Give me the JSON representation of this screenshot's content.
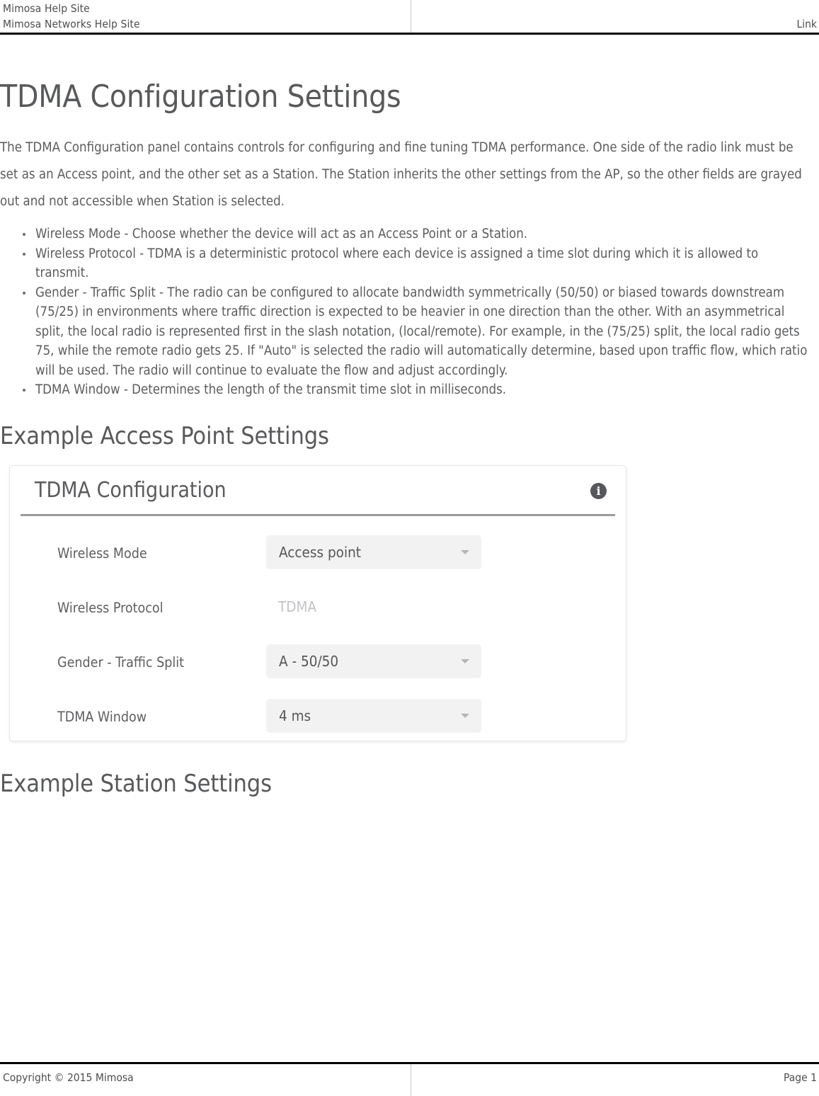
{
  "header": {
    "line1": "Mimosa Help Site",
    "line2": "Mimosa Networks Help Site",
    "right_label": "Link"
  },
  "document": {
    "title": "TDMA Configuration Settings",
    "intro": "The TDMA Configuration panel contains controls for configuring and fine tuning TDMA performance. One side of the radio link must be set as an Access point, and the other set as a Station. The Station inherits the other settings from the AP, so the other fields are grayed out and not accessible when Station is selected.",
    "bullets": [
      "Wireless Mode - Choose whether the device will act as an Access Point or a Station.",
      "Wireless Protocol -  TDMA is a deterministic protocol where each device is assigned a time slot during which it is allowed to transmit.",
      "Gender - Traffic Split - The radio can be configured to allocate bandwidth symmetrically (50/50) or biased towards downstream (75/25) in environments where traffic direction is expected to be heavier in one direction than the other. With an asymmetrical split, the local radio is represented first in the slash notation, (local/remote). For example, in the (75/25) split, the local radio gets 75, while the remote radio gets 25. If \"Auto\" is selected the radio will automatically determine, based upon traffic flow, which ratio will be used. The radio will continue to evaluate the flow and adjust accordingly.",
      "TDMA Window - Determines the length of the transmit time slot in milliseconds."
    ],
    "section_ap_title": "Example Access Point Settings",
    "section_station_title": "Example Station Settings"
  },
  "panel": {
    "title": "TDMA Configuration",
    "info_icon": "info-icon",
    "info_glyph": "i",
    "rows": [
      {
        "label": "Wireless Mode",
        "value": "Access point",
        "control": "dropdown"
      },
      {
        "label": "Wireless Protocol",
        "value": "TDMA",
        "control": "readonly"
      },
      {
        "label": "Gender - Traffic Split",
        "value": "A - 50/50",
        "control": "dropdown"
      },
      {
        "label": "TDMA Window",
        "value": "4 ms",
        "control": "dropdown"
      }
    ]
  },
  "footer": {
    "copyright": "Copyright © 2015 Mimosa",
    "page": "Page 1"
  },
  "colors": {
    "text": "#5b5c5e",
    "heading": "#58595b",
    "control_bg": "#f2f2f2",
    "info_icon_bg": "#56585c",
    "disabled_text": "#c2c3c6",
    "rule": "#000000"
  }
}
